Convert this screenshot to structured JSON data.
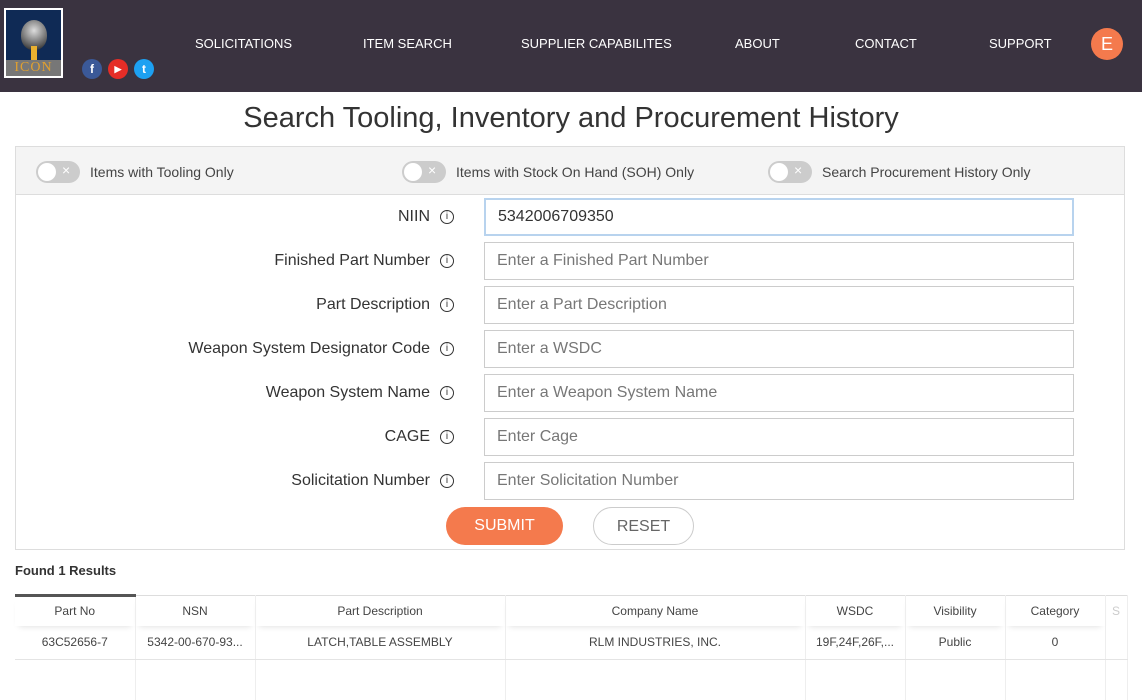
{
  "header": {
    "logo_text": "ICON",
    "social": [
      {
        "name": "facebook",
        "glyph": "f",
        "color": "#3b5998"
      },
      {
        "name": "youtube",
        "glyph": "▶",
        "color": "#e52d27"
      },
      {
        "name": "twitter",
        "glyph": "t",
        "color": "#1da1f2"
      }
    ],
    "nav": [
      "SOLICITATIONS",
      "ITEM SEARCH",
      "SUPPLIER CAPABILITES",
      "ABOUT",
      "CONTACT",
      "SUPPORT"
    ],
    "avatar": "E"
  },
  "page_title": "Search Tooling, Inventory and Procurement History",
  "toggles": [
    "Items with Tooling Only",
    "Items with Stock On Hand (SOH) Only",
    "Search Procurement History Only"
  ],
  "fields": [
    {
      "label": "NIIN",
      "value": "5342006709350",
      "placeholder": ""
    },
    {
      "label": "Finished Part Number",
      "value": "",
      "placeholder": "Enter a Finished Part Number"
    },
    {
      "label": "Part Description",
      "value": "",
      "placeholder": "Enter a Part Description"
    },
    {
      "label": "Weapon System Designator Code",
      "value": "",
      "placeholder": "Enter a WSDC"
    },
    {
      "label": "Weapon System Name",
      "value": "",
      "placeholder": "Enter a Weapon System Name"
    },
    {
      "label": "CAGE",
      "value": "",
      "placeholder": "Enter Cage"
    },
    {
      "label": "Solicitation Number",
      "value": "",
      "placeholder": "Enter Solicitation Number"
    }
  ],
  "info_glyph": "i",
  "buttons": {
    "submit": "SUBMIT",
    "reset": "RESET"
  },
  "results": {
    "found": "Found 1 Results",
    "columns": [
      "Part No",
      "NSN",
      "Part Description",
      "Company Name",
      "WSDC",
      "Visibility",
      "Category",
      "S"
    ],
    "rows": [
      [
        "63C52656-7",
        "5342-00-670-93...",
        "LATCH,TABLE ASSEMBLY",
        "RLM INDUSTRIES, INC.",
        "19F,24F,26F,...",
        "Public",
        "0",
        ""
      ]
    ]
  },
  "colors": {
    "header_bg": "#3a3340",
    "accent": "#f47a4d"
  }
}
